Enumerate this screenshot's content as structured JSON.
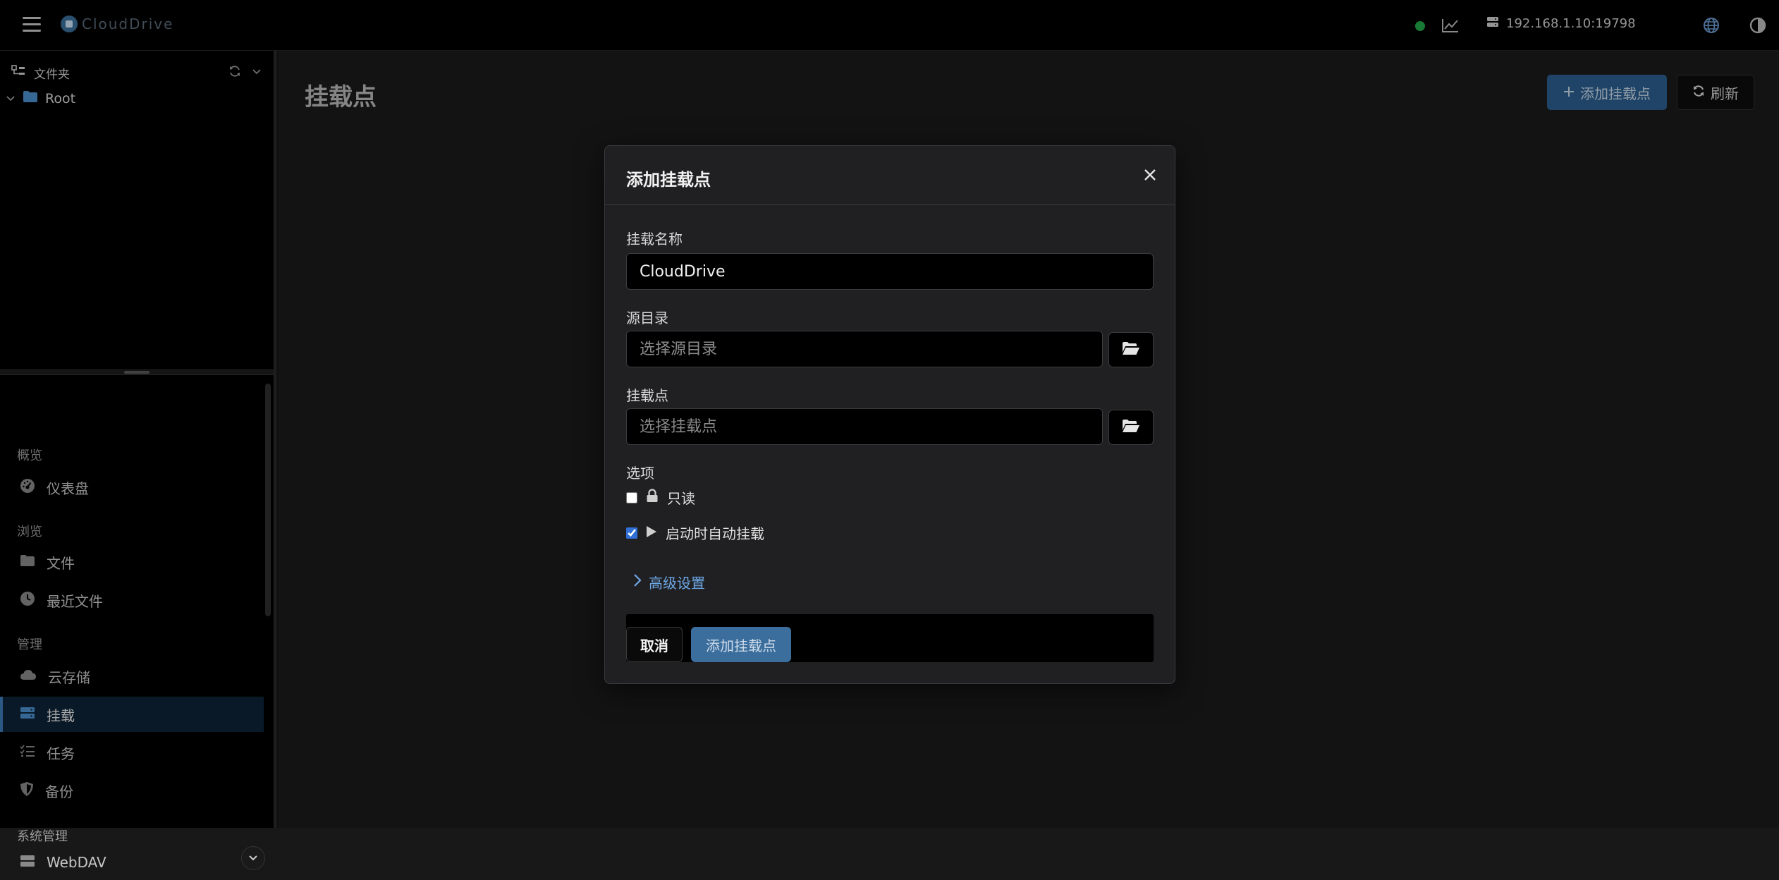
{
  "app": {
    "logo_text": "CloudDrive"
  },
  "topbar": {
    "server_address": "192.168.1.10:19798",
    "status_color": "#22a84a",
    "icons": [
      "menu-icon",
      "stats-chart-icon",
      "server-icon",
      "globe-icon",
      "contrast-icon",
      "account-icon"
    ]
  },
  "sidebar": {
    "folder_header": "文件夹",
    "tree_root": "Root",
    "sections": {
      "overview": "概览",
      "browse": "浏览",
      "manage": "管理",
      "system": "系统管理"
    },
    "items": {
      "dashboard": "仪表盘",
      "files": "文件",
      "recent": "最近文件",
      "cloud": "云存储",
      "mount": "挂载",
      "tasks": "任务",
      "backup": "备份",
      "webdav": "WebDAV"
    },
    "active_item": "mount"
  },
  "main": {
    "title": "挂载点",
    "add_button": "添加挂载点",
    "refresh_button": "刷新"
  },
  "modal": {
    "title": "添加挂载点",
    "mount_name_label": "挂载名称",
    "mount_name_value": "CloudDrive",
    "source_label": "源目录",
    "source_placeholder": "选择源目录",
    "mountpoint_label": "挂载点",
    "mountpoint_placeholder": "选择挂载点",
    "options_label": "选项",
    "option_readonly": "只读",
    "option_readonly_checked": false,
    "option_automount": "启动时自动挂载",
    "option_automount_checked": true,
    "advanced_label": "高级设置",
    "cancel_button": "取消",
    "submit_button": "添加挂载点"
  },
  "colors": {
    "accent": "#3b6e9d",
    "link": "#6ea8e6",
    "active_nav_bg": "#0f2336"
  }
}
